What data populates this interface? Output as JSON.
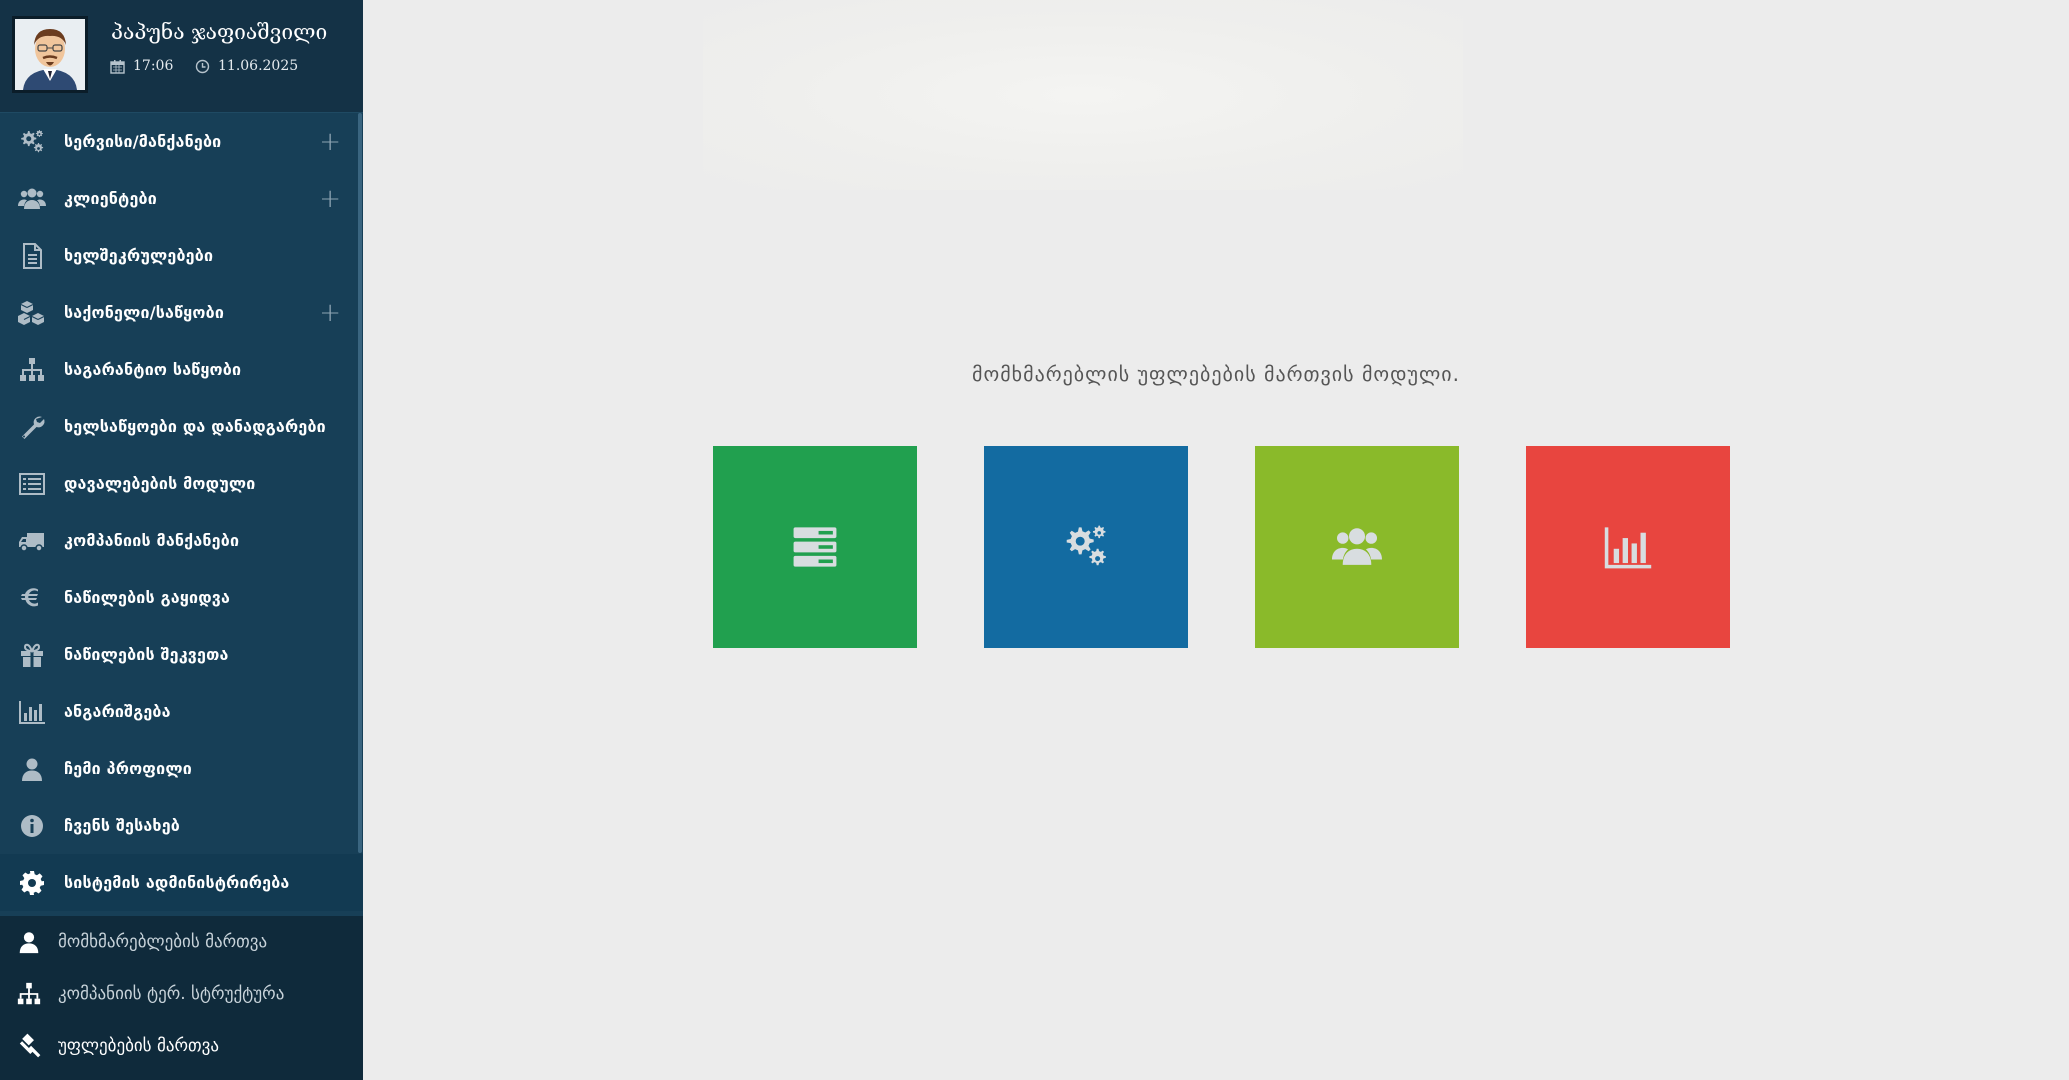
{
  "user": {
    "name": "პაპუნა ჯაფიაშვილი",
    "time": "17:06",
    "date": "11.06.2025"
  },
  "menu": [
    {
      "label": "სერვისი/მანქანები",
      "icon": "cogs-icon",
      "expandable": true
    },
    {
      "label": "კლიენტები",
      "icon": "users-icon",
      "expandable": true
    },
    {
      "label": "ხელშეკრულებები",
      "icon": "document-icon",
      "expandable": false
    },
    {
      "label": "საქონელი/საწყობი",
      "icon": "cubes-icon",
      "expandable": true
    },
    {
      "label": "საგარანტიო საწყობი",
      "icon": "sitemap-icon",
      "expandable": false
    },
    {
      "label": "ხელსაწყოები და დანადგარები",
      "icon": "wrench-icon",
      "expandable": false
    },
    {
      "label": "დავალებების მოდული",
      "icon": "list-icon",
      "expandable": false
    },
    {
      "label": "კომპანიის მანქანები",
      "icon": "truck-icon",
      "expandable": false
    },
    {
      "label": "ნაწილების გაყიდვა",
      "icon": "euro-icon",
      "expandable": false
    },
    {
      "label": "ნაწილების შეკვეთა",
      "icon": "gift-icon",
      "expandable": false
    },
    {
      "label": "ანგარიშგება",
      "icon": "bar-chart-icon",
      "expandable": false
    },
    {
      "label": "ჩემი პროფილი",
      "icon": "user-icon",
      "expandable": false
    },
    {
      "label": "ჩვენს შესახებ",
      "icon": "info-icon",
      "expandable": false
    },
    {
      "label": "სისტემის ადმინისტრირება",
      "icon": "gear-icon",
      "expandable": false,
      "active": true
    }
  ],
  "expand_symbol": "+",
  "submenu": [
    {
      "label": "მომხმარებლების მართვა",
      "icon": "user-icon"
    },
    {
      "label": "კომპანიის ტერ. სტრუქტურა",
      "icon": "sitemap-icon"
    },
    {
      "label": "უფლებების მართვა",
      "icon": "gavel-icon",
      "current": true
    }
  ],
  "main": {
    "title": "მომხმარებლის უფლებების მართვის მოდული.",
    "tiles": [
      {
        "icon": "server-icon",
        "color": "#21a04f"
      },
      {
        "icon": "cogs-icon",
        "color": "#136ba1"
      },
      {
        "icon": "users-icon",
        "color": "#8aba2a"
      },
      {
        "icon": "bar-chart-icon",
        "color": "#e8453f"
      }
    ]
  },
  "colors": {
    "sidebar": "#173f57",
    "sidebar_header": "#143246",
    "submenu": "#0f2a3b",
    "background": "#ececec"
  }
}
